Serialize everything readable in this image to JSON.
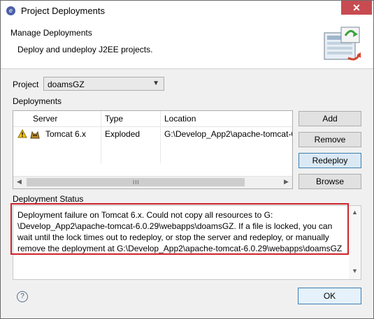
{
  "window": {
    "title": "Project Deployments",
    "close_symbol": "✕"
  },
  "header": {
    "title": "Manage Deployments",
    "description": "Deploy and undeploy J2EE projects."
  },
  "project": {
    "label": "Project",
    "selected": "doamsGZ"
  },
  "deployments": {
    "label": "Deployments",
    "columns": [
      "Server",
      "Type",
      "Location"
    ],
    "rows": [
      {
        "warning": true,
        "server": "Tomcat  6.x",
        "type": "Exploded",
        "location": "G:\\Develop_App2\\apache-tomcat-6"
      }
    ],
    "scroll_grip": "III"
  },
  "buttons": {
    "add": "Add",
    "remove": "Remove",
    "redeploy": "Redeploy",
    "browse": "Browse"
  },
  "status": {
    "label": "Deployment Status",
    "lines": [
      "Deployment failure on Tomcat  6.x. Could not copy all resources to G:",
      "\\Develop_App2\\apache-tomcat-6.0.29\\webapps\\doamsGZ. If a file is locked, you can",
      "wait until the lock times out to redeploy, or stop the server and redeploy, or manually",
      "remove the deployment at G:\\Develop_App2\\apache-tomcat-6.0.29\\webapps\\doamsGZ"
    ]
  },
  "footer": {
    "help_symbol": "?",
    "ok": "OK"
  },
  "colors": {
    "highlight": "#d0222a",
    "close": "#c74b50",
    "focus": "#3c7fb1"
  }
}
